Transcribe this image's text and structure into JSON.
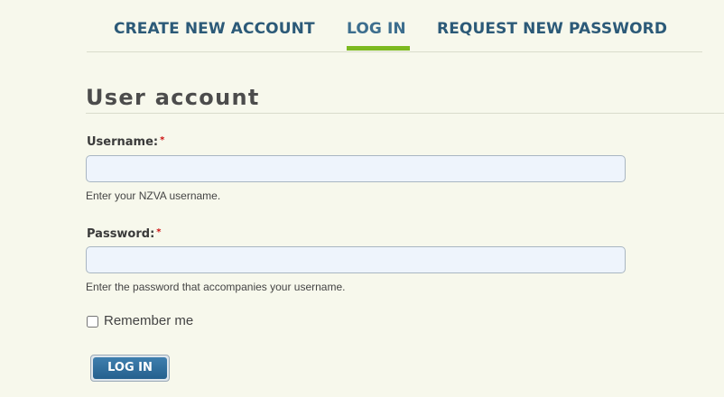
{
  "tabs": [
    {
      "label": "CREATE NEW ACCOUNT",
      "active": false
    },
    {
      "label": "LOG IN",
      "active": true
    },
    {
      "label": "REQUEST NEW PASSWORD",
      "active": false
    }
  ],
  "page": {
    "title": "User account"
  },
  "form": {
    "username": {
      "label": "Username:",
      "required_marker": "*",
      "value": "",
      "help": "Enter your NZVA username."
    },
    "password": {
      "label": "Password:",
      "required_marker": "*",
      "value": "",
      "help": "Enter the password that accompanies your username."
    },
    "remember": {
      "label": "Remember me",
      "checked": false
    },
    "submit_label": "LOG IN"
  },
  "colors": {
    "background": "#f7f8ec",
    "tab_text": "#2c5a78",
    "active_tab_accent": "#7cb91f",
    "required_marker": "#cc1111",
    "input_background": "#eef4fc",
    "button": "#2f6b99"
  }
}
